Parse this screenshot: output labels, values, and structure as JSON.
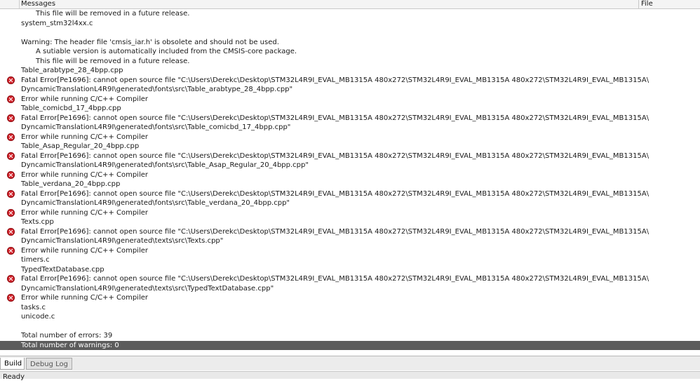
{
  "header": {
    "messages_label": "Messages",
    "file_label": "File"
  },
  "messages": [
    {
      "text": "This file will be removed in a future release.",
      "indent": 2,
      "error": false
    },
    {
      "text": "system_stm32l4xx.c",
      "indent": 1,
      "error": false
    },
    {
      "text": "",
      "indent": 1,
      "error": false
    },
    {
      "text": "Warning: The header file 'cmsis_iar.h' is obsolete and should not be used.",
      "indent": 1,
      "error": false
    },
    {
      "text": "A sutiable version is automatically included from the CMSIS-core package.",
      "indent": 2,
      "error": false
    },
    {
      "text": "This file will be removed in a future release.",
      "indent": 2,
      "error": false
    },
    {
      "text": "Table_arabtype_28_4bpp.cpp",
      "indent": 1,
      "error": false
    },
    {
      "text": "Fatal Error[Pe1696]: cannot open source file \"C:\\Users\\Derekc\\Desktop\\STM32L4R9I_EVAL_MB1315A 480x272\\STM32L4R9I_EVAL_MB1315A 480x272\\STM32L4R9I_EVAL_MB1315A\\",
      "indent": 1,
      "error": true
    },
    {
      "text": "DyncamicTranslationL4R9I\\generated\\fonts\\src\\Table_arabtype_28_4bpp.cpp\"",
      "indent": 1,
      "error": false
    },
    {
      "text": "Error while running C/C++ Compiler",
      "indent": 1,
      "error": true
    },
    {
      "text": "Table_comicbd_17_4bpp.cpp",
      "indent": 1,
      "error": false
    },
    {
      "text": "Fatal Error[Pe1696]: cannot open source file \"C:\\Users\\Derekc\\Desktop\\STM32L4R9I_EVAL_MB1315A 480x272\\STM32L4R9I_EVAL_MB1315A 480x272\\STM32L4R9I_EVAL_MB1315A\\",
      "indent": 1,
      "error": true
    },
    {
      "text": "DyncamicTranslationL4R9I\\generated\\fonts\\src\\Table_comicbd_17_4bpp.cpp\"",
      "indent": 1,
      "error": false
    },
    {
      "text": "Error while running C/C++ Compiler",
      "indent": 1,
      "error": true
    },
    {
      "text": "Table_Asap_Regular_20_4bpp.cpp",
      "indent": 1,
      "error": false
    },
    {
      "text": "Fatal Error[Pe1696]: cannot open source file \"C:\\Users\\Derekc\\Desktop\\STM32L4R9I_EVAL_MB1315A 480x272\\STM32L4R9I_EVAL_MB1315A 480x272\\STM32L4R9I_EVAL_MB1315A\\",
      "indent": 1,
      "error": true
    },
    {
      "text": "DyncamicTranslationL4R9I\\generated\\fonts\\src\\Table_Asap_Regular_20_4bpp.cpp\"",
      "indent": 1,
      "error": false
    },
    {
      "text": "Error while running C/C++ Compiler",
      "indent": 1,
      "error": true
    },
    {
      "text": "Table_verdana_20_4bpp.cpp",
      "indent": 1,
      "error": false
    },
    {
      "text": "Fatal Error[Pe1696]: cannot open source file \"C:\\Users\\Derekc\\Desktop\\STM32L4R9I_EVAL_MB1315A 480x272\\STM32L4R9I_EVAL_MB1315A 480x272\\STM32L4R9I_EVAL_MB1315A\\",
      "indent": 1,
      "error": true
    },
    {
      "text": "DyncamicTranslationL4R9I\\generated\\fonts\\src\\Table_verdana_20_4bpp.cpp\"",
      "indent": 1,
      "error": false
    },
    {
      "text": "Error while running C/C++ Compiler",
      "indent": 1,
      "error": true
    },
    {
      "text": "Texts.cpp",
      "indent": 1,
      "error": false
    },
    {
      "text": "Fatal Error[Pe1696]: cannot open source file \"C:\\Users\\Derekc\\Desktop\\STM32L4R9I_EVAL_MB1315A 480x272\\STM32L4R9I_EVAL_MB1315A 480x272\\STM32L4R9I_EVAL_MB1315A\\",
      "indent": 1,
      "error": true
    },
    {
      "text": "DyncamicTranslationL4R9I\\generated\\texts\\src\\Texts.cpp\"",
      "indent": 1,
      "error": false
    },
    {
      "text": "Error while running C/C++ Compiler",
      "indent": 1,
      "error": true
    },
    {
      "text": "timers.c",
      "indent": 1,
      "error": false
    },
    {
      "text": "TypedTextDatabase.cpp",
      "indent": 1,
      "error": false
    },
    {
      "text": "Fatal Error[Pe1696]: cannot open source file \"C:\\Users\\Derekc\\Desktop\\STM32L4R9I_EVAL_MB1315A 480x272\\STM32L4R9I_EVAL_MB1315A 480x272\\STM32L4R9I_EVAL_MB1315A\\",
      "indent": 1,
      "error": true
    },
    {
      "text": "DyncamicTranslationL4R9I\\generated\\texts\\src\\TypedTextDatabase.cpp\"",
      "indent": 1,
      "error": false
    },
    {
      "text": "Error while running C/C++ Compiler",
      "indent": 1,
      "error": true
    },
    {
      "text": "tasks.c",
      "indent": 1,
      "error": false
    },
    {
      "text": "unicode.c",
      "indent": 1,
      "error": false
    },
    {
      "text": "",
      "indent": 1,
      "error": false
    },
    {
      "text": "Total number of errors: 39",
      "indent": 1,
      "error": false
    },
    {
      "text": "Total number of warnings: 0",
      "indent": 1,
      "error": false,
      "selected": true
    }
  ],
  "tabs": [
    {
      "label": "Build",
      "active": true
    },
    {
      "label": "Debug Log",
      "active": false
    }
  ],
  "status": {
    "text": "Ready"
  },
  "colors": {
    "error_icon": "#d3222a",
    "selected_row": "#5c5c5c"
  }
}
